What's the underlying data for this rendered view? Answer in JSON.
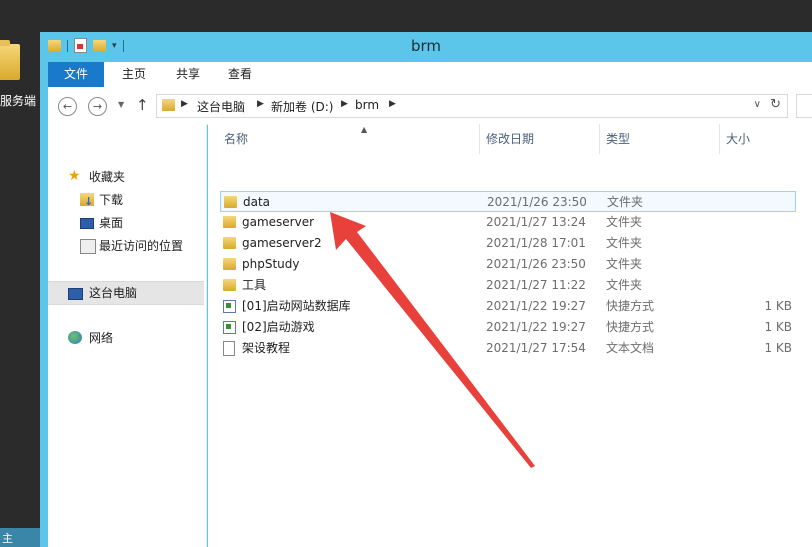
{
  "desktop": {
    "icon_label": "服务端",
    "taskbar_label": "主"
  },
  "window": {
    "title": "brm"
  },
  "ribbon": {
    "tabs": [
      "文件",
      "主页",
      "共享",
      "查看"
    ]
  },
  "address": {
    "crumbs": [
      "这台电脑",
      "新加卷 (D:)",
      "brm"
    ]
  },
  "navpane": {
    "items": [
      {
        "label": "收藏夹",
        "icon": "star-icon"
      },
      {
        "label": "下载",
        "icon": "downloads-folder-icon"
      },
      {
        "label": "桌面",
        "icon": "desktop-icon"
      },
      {
        "label": "最近访问的位置",
        "icon": "recent-places-icon"
      },
      {
        "label": "这台电脑",
        "icon": "computer-icon"
      },
      {
        "label": "网络",
        "icon": "network-icon"
      }
    ]
  },
  "columns": {
    "name": "名称",
    "date": "修改日期",
    "type": "类型",
    "size": "大小"
  },
  "files": [
    {
      "name": "data",
      "date": "2021/1/26 23:50",
      "type": "文件夹",
      "size": "",
      "icon": "folder-icon"
    },
    {
      "name": "gameserver",
      "date": "2021/1/27 13:24",
      "type": "文件夹",
      "size": "",
      "icon": "folder-icon"
    },
    {
      "name": "gameserver2",
      "date": "2021/1/28 17:01",
      "type": "文件夹",
      "size": "",
      "icon": "folder-icon"
    },
    {
      "name": "phpStudy",
      "date": "2021/1/26 23:50",
      "type": "文件夹",
      "size": "",
      "icon": "folder-icon"
    },
    {
      "name": "工具",
      "date": "2021/1/27 11:22",
      "type": "文件夹",
      "size": "",
      "icon": "folder-icon"
    },
    {
      "name": "[01]启动网站数据库",
      "date": "2021/1/22 19:27",
      "type": "快捷方式",
      "size": "1 KB",
      "icon": "shortcut-icon"
    },
    {
      "name": "[02]启动游戏",
      "date": "2021/1/22 19:27",
      "type": "快捷方式",
      "size": "1 KB",
      "icon": "shortcut-icon"
    },
    {
      "name": "架设教程",
      "date": "2021/1/27 17:54",
      "type": "文本文档",
      "size": "1 KB",
      "icon": "text-document-icon"
    }
  ],
  "colors": {
    "titlebar": "#5bc6ea",
    "file_tab": "#1979ca",
    "annotation_arrow": "#e8413b"
  }
}
